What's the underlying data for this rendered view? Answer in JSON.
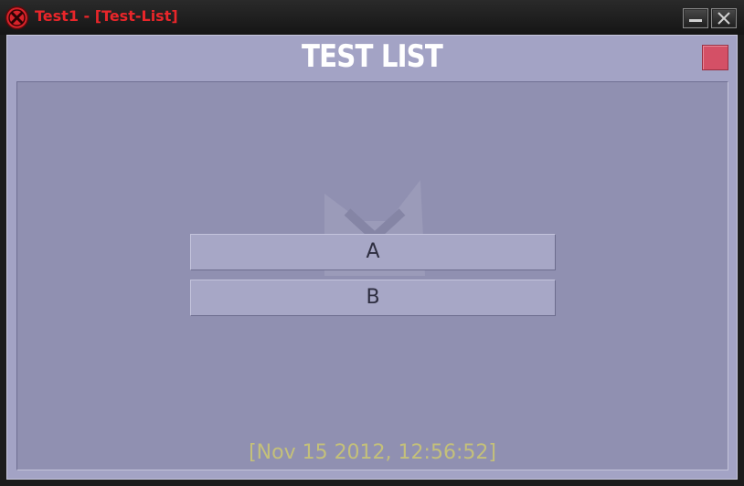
{
  "window": {
    "title": "Test1 - [Test-List]"
  },
  "header": {
    "title": "TEST LIST"
  },
  "list": {
    "items": [
      {
        "label": "A"
      },
      {
        "label": "B"
      }
    ]
  },
  "status": {
    "timestamp": "[Nov 15 2012, 12:56:52]"
  },
  "icons": {
    "app": "app-x-icon",
    "minimize": "minimize-icon",
    "close": "close-icon",
    "watermark": "logo-watermark-icon"
  },
  "colors": {
    "title_text": "#e8262a",
    "client_bg": "#a3a3c5",
    "panel_bg": "#9090b1",
    "button_bg": "#a7a7c6",
    "red_square": "#d45066",
    "timestamp": "#c4c07a"
  }
}
